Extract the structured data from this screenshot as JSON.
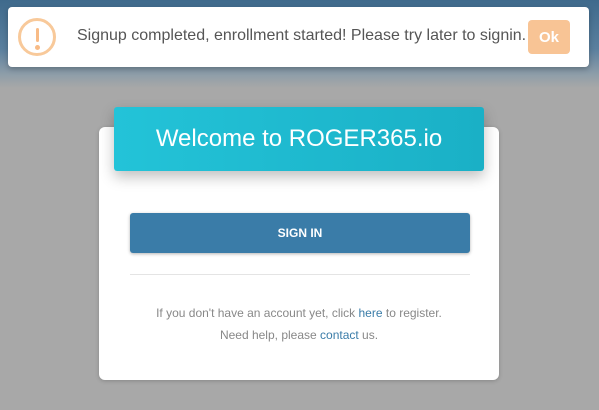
{
  "alert": {
    "icon": "exclamation-icon",
    "message": "Signup completed, enrollment started! Please try later to signin.",
    "ok_label": "Ok",
    "icon_color": "#f8bb86",
    "button_color": "#f8c495"
  },
  "card": {
    "title": "Welcome to ROGER365.io",
    "header_color": "#1ab0c6",
    "signin_label": "SIGN IN",
    "signin_color": "#3a7ca8",
    "register": {
      "prefix": "If you don't have an account yet, click ",
      "link": "here",
      "suffix": " to register."
    },
    "help": {
      "prefix": "Need help, please ",
      "link": "contact",
      "suffix": " us."
    }
  }
}
